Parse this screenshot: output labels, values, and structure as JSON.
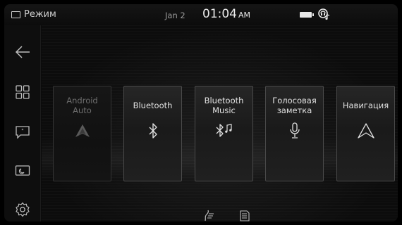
{
  "status_bar": {
    "mode_label": "Режим",
    "date": "Jan 2",
    "time": "01:04",
    "ampm": "AM",
    "battery_icon": "battery-icon",
    "phone_audio_icon": "phone-audio-icon"
  },
  "sidebar": {
    "items": [
      {
        "name": "back",
        "icon": "back-arrow-icon"
      },
      {
        "name": "apps-grid",
        "icon": "grid-icon"
      },
      {
        "name": "messages",
        "icon": "message-icon"
      },
      {
        "name": "display",
        "icon": "screen-icon"
      },
      {
        "name": "settings",
        "icon": "gear-icon"
      }
    ]
  },
  "apps": [
    {
      "label": "Android Auto",
      "icon": "android-auto-icon",
      "enabled": false
    },
    {
      "label": "Bluetooth",
      "icon": "bluetooth-icon",
      "enabled": true
    },
    {
      "label": "Bluetooth Music",
      "icon": "bluetooth-music-icon",
      "enabled": true
    },
    {
      "label": "Голосовая заметка",
      "icon": "microphone-icon",
      "enabled": true
    },
    {
      "label": "Навигация",
      "icon": "navigation-icon",
      "enabled": true
    }
  ],
  "bottom_bar": {
    "icons": [
      "air-flow-icon",
      "heated-seat-icon"
    ]
  },
  "colors": {
    "background": "#0b0b0b",
    "tile_border": "#4a4a4a",
    "text": "#e2e2e2",
    "disabled_text": "#6d6d6d"
  }
}
